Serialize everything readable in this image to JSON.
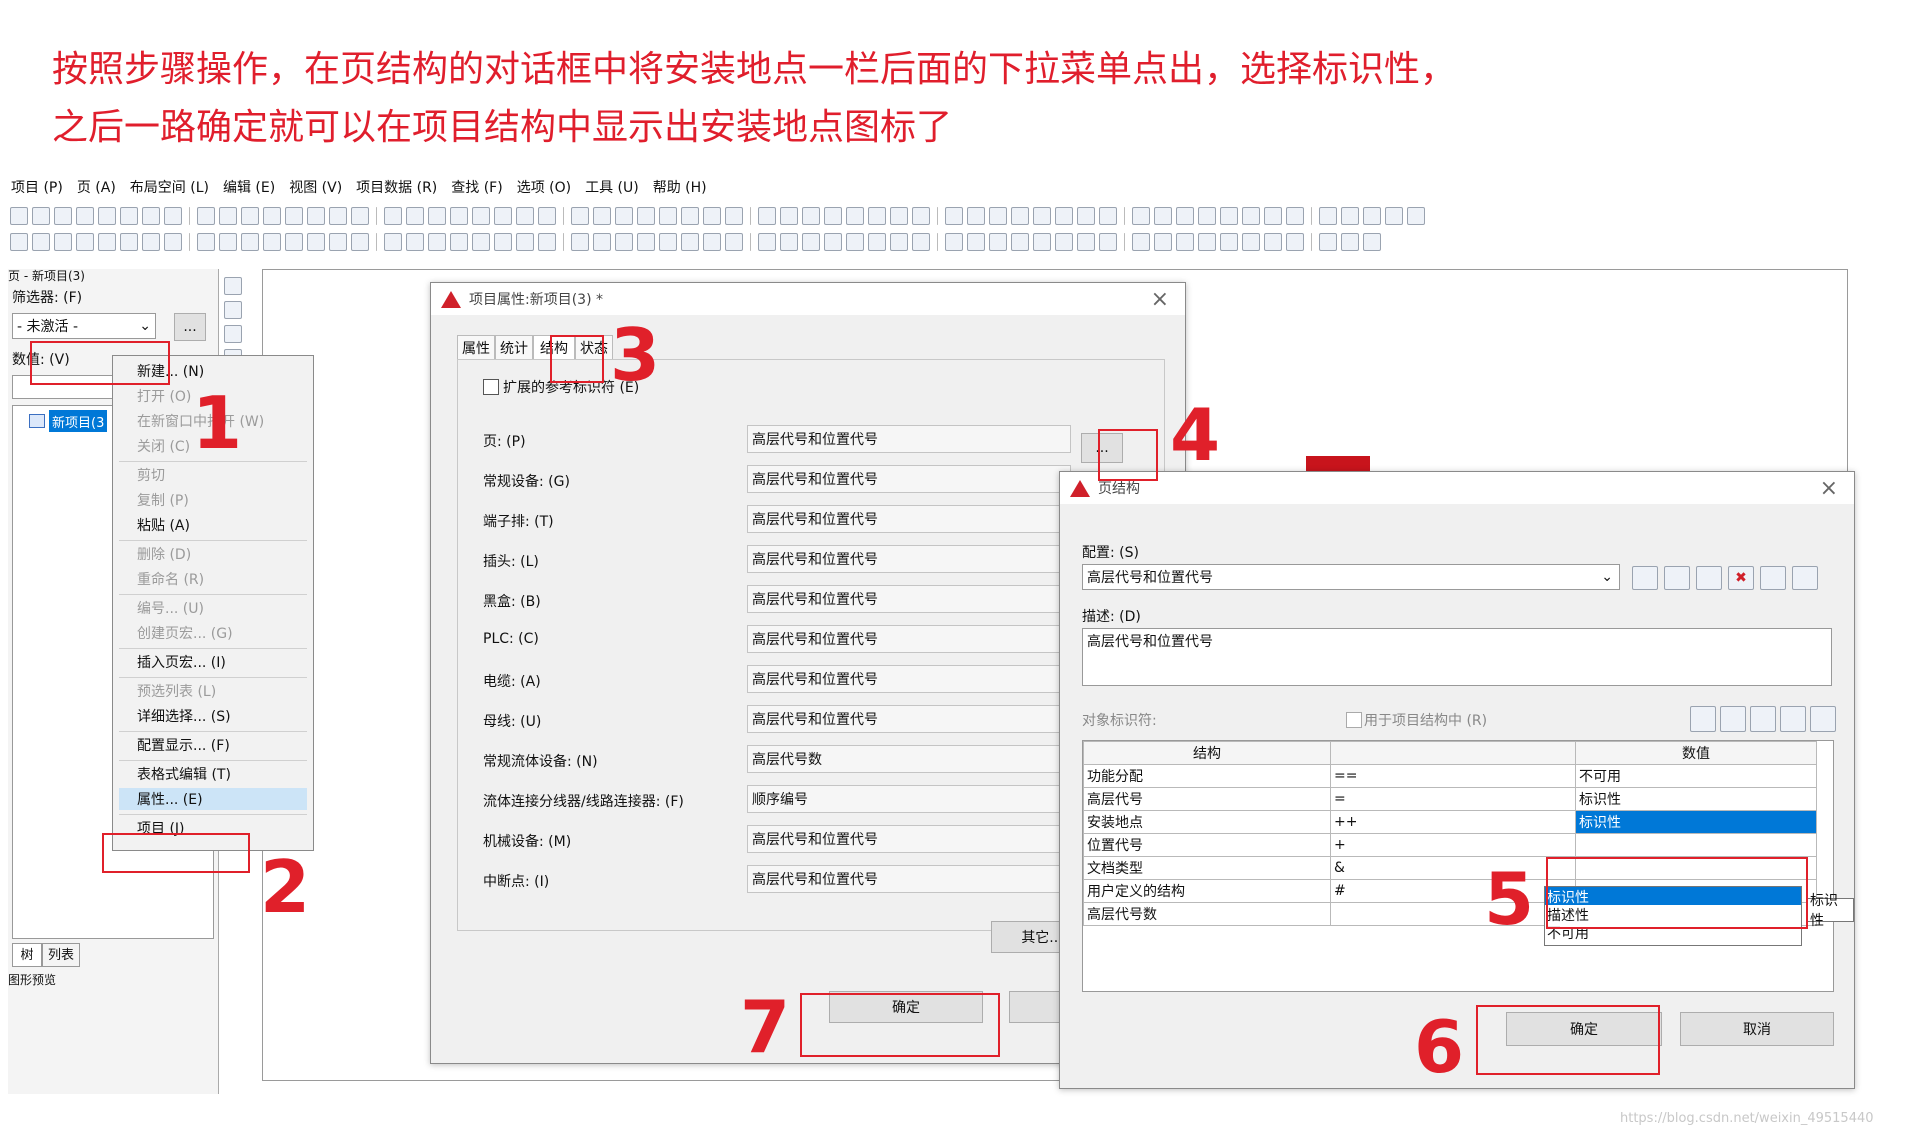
{
  "caption": {
    "line1": "按照步骤操作，在页结构的对话框中将安装地点一栏后面的下拉菜单点出，选择标识性，",
    "line2": "之后一路确定就可以在项目结构中显示出安装地点图标了"
  },
  "menubar": [
    "项目 (P)",
    "页 (A)",
    "布局空间 (L)",
    "编辑 (E)",
    "视图 (V)",
    "项目数据 (R)",
    "查找 (F)",
    "选项 (O)",
    "工具 (U)",
    "帮助 (H)"
  ],
  "left_panel": {
    "title": "页 - 新项目(3)",
    "filter_label": "筛选器: (F)",
    "filter_value": "- 未激活 -",
    "filter_button": "...",
    "value_label": "数值: (V)",
    "tree_item": "新项目(3",
    "tabs": [
      "树",
      "列表"
    ],
    "preview_label": "图形预览"
  },
  "context_menu": {
    "items": [
      {
        "label": "新建... (N)",
        "enabled": true
      },
      {
        "label": "打开 (O)",
        "enabled": false
      },
      {
        "label": "在新窗口中打开 (W)",
        "enabled": false
      },
      {
        "label": "关闭 (C)",
        "enabled": false
      },
      {
        "label": "剪切",
        "enabled": false
      },
      {
        "label": "复制 (P)",
        "enabled": false
      },
      {
        "label": "粘贴 (A)",
        "enabled": true
      },
      {
        "label": "删除 (D)",
        "enabled": false
      },
      {
        "label": "重命名 (R)",
        "enabled": false
      },
      {
        "label": "编号... (U)",
        "enabled": false
      },
      {
        "label": "创建页宏... (G)",
        "enabled": false
      },
      {
        "label": "插入页宏... (I)",
        "enabled": true
      },
      {
        "label": "预选列表 (L)",
        "enabled": false
      },
      {
        "label": "详细选择... (S)",
        "enabled": true
      },
      {
        "label": "配置显示... (F)",
        "enabled": true
      },
      {
        "label": "表格式编辑 (T)",
        "enabled": true
      },
      {
        "label": "属性... (E)",
        "enabled": true
      },
      {
        "label": "项目 (J)",
        "enabled": true
      }
    ]
  },
  "project_dialog": {
    "title": "项目属性:新项目(3) *",
    "tabs": [
      "属性",
      "统计",
      "结构",
      "状态"
    ],
    "checkbox_label": "扩展的参考标识符 (E)",
    "rows": [
      {
        "label": "页: (P)",
        "value": "高层代号和位置代号"
      },
      {
        "label": "常规设备: (G)",
        "value": "高层代号和位置代号"
      },
      {
        "label": "端子排: (T)",
        "value": "高层代号和位置代号"
      },
      {
        "label": "插头: (L)",
        "value": "高层代号和位置代号"
      },
      {
        "label": "黑盒: (B)",
        "value": "高层代号和位置代号"
      },
      {
        "label": "PLC: (C)",
        "value": "高层代号和位置代号"
      },
      {
        "label": "电缆: (A)",
        "value": "高层代号和位置代号"
      },
      {
        "label": "母线: (U)",
        "value": "高层代号和位置代号"
      },
      {
        "label": "常规流体设备: (N)",
        "value": "高层代号数"
      },
      {
        "label": "流体连接分线器/线路连接器: (F)",
        "value": "顺序编号"
      },
      {
        "label": "机械设备: (M)",
        "value": "高层代号和位置代号"
      },
      {
        "label": "中断点: (I)",
        "value": "高层代号和位置代号"
      }
    ],
    "browse_button": "...",
    "other_button": "其它...",
    "ok_button": "确定"
  },
  "page_structure_dialog": {
    "title": "页结构",
    "config_label": "配置: (S)",
    "config_value": "高层代号和位置代号",
    "desc_label": "描述: (D)",
    "desc_value": "高层代号和位置代号",
    "object_id_label": "对象标识符:",
    "use_in_project_label": "用于项目结构中 (R)",
    "columns": [
      "结构",
      "",
      "数值"
    ],
    "rows": [
      {
        "structure": "功能分配",
        "prefix": "==",
        "value": "不可用"
      },
      {
        "structure": "高层代号",
        "prefix": "=",
        "value": "标识性"
      },
      {
        "structure": "安装地点",
        "prefix": "++",
        "value": "标识性"
      },
      {
        "structure": "位置代号",
        "prefix": "+",
        "value": ""
      },
      {
        "structure": "文档类型",
        "prefix": "&",
        "value": ""
      },
      {
        "structure": "用户定义的结构",
        "prefix": "#",
        "value": ""
      },
      {
        "structure": "高层代号数",
        "prefix": "",
        "value": "不可用"
      }
    ],
    "dropdown_options": [
      "标识性",
      "描述性",
      "不可用"
    ],
    "dropdown_selected": "标识性",
    "tooltip_fragment": "标识性",
    "ok_button": "确定",
    "cancel_button": "取消"
  },
  "step_numbers": [
    "1",
    "2",
    "3",
    "4",
    "5",
    "6",
    "7"
  ],
  "watermark": "https://blog.csdn.net/weixin_49515440",
  "colors": {
    "annotation_red": "#e0202a",
    "selection_blue": "#0078d7"
  }
}
